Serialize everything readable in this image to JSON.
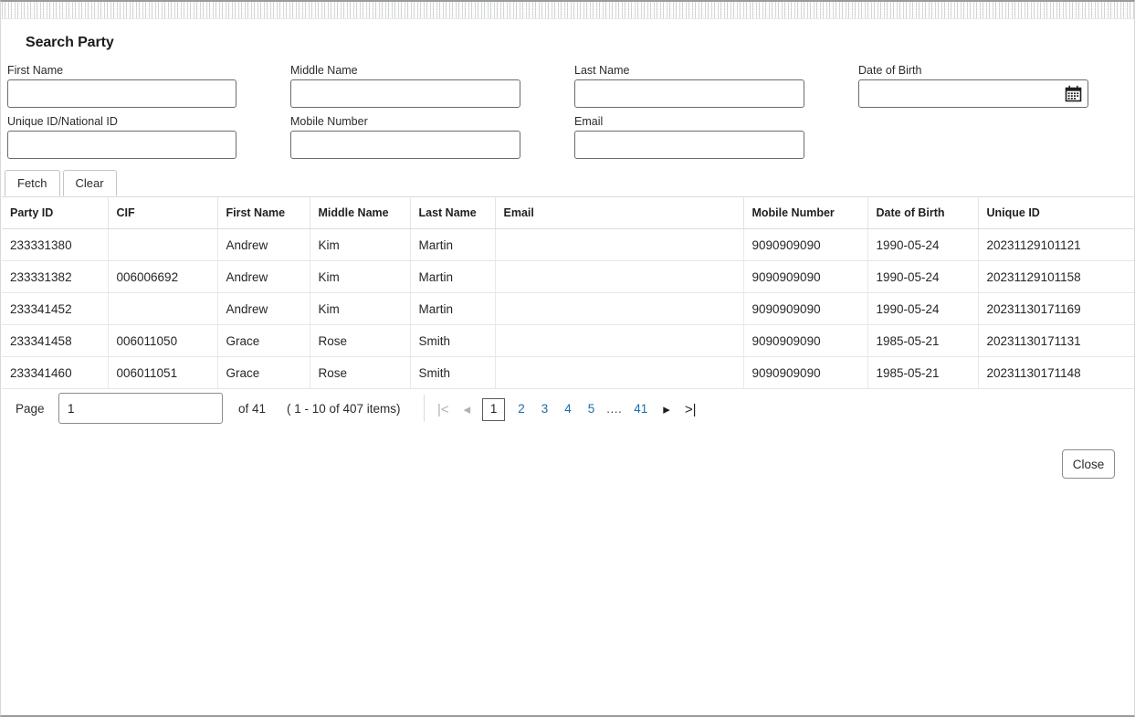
{
  "window": {
    "title": "Search Party"
  },
  "search_form": {
    "fields": [
      {
        "label": "First Name",
        "value": "",
        "placeholder": "",
        "name": "first-name"
      },
      {
        "label": "Middle Name",
        "value": "",
        "placeholder": "",
        "name": "middle-name"
      },
      {
        "label": "Last Name",
        "value": "",
        "placeholder": "",
        "name": "last-name"
      },
      {
        "label": "Date of Birth",
        "value": "",
        "placeholder": "",
        "name": "date-of-birth"
      },
      {
        "label": "Unique ID/National ID",
        "value": "",
        "placeholder": "",
        "name": "unique-id"
      },
      {
        "label": "Mobile Number",
        "value": "",
        "placeholder": "",
        "name": "mobile-number"
      },
      {
        "label": "Email",
        "value": "",
        "placeholder": "",
        "name": "email"
      }
    ],
    "calendar_icon": "calendar-icon",
    "buttons": {
      "fetch": "Fetch",
      "clear": "Clear"
    }
  },
  "results": {
    "columns": [
      "Party ID",
      "CIF",
      "First Name",
      "Middle Name",
      "Last Name",
      "Email",
      "Mobile Number",
      "Date of Birth",
      "Unique ID"
    ],
    "rows": [
      {
        "party_id": "233331380",
        "cif": "",
        "first_name": "Andrew",
        "middle_name": "Kim",
        "last_name": "Martin",
        "email": "",
        "mobile_number": "9090909090",
        "date_of_birth": "1990-05-24",
        "unique_id": "20231129101121"
      },
      {
        "party_id": "233331382",
        "cif": "006006692",
        "first_name": "Andrew",
        "middle_name": "Kim",
        "last_name": "Martin",
        "email": "",
        "mobile_number": "9090909090",
        "date_of_birth": "1990-05-24",
        "unique_id": "20231129101158"
      },
      {
        "party_id": "233341452",
        "cif": "",
        "first_name": "Andrew",
        "middle_name": "Kim",
        "last_name": "Martin",
        "email": "",
        "mobile_number": "9090909090",
        "date_of_birth": "1990-05-24",
        "unique_id": "20231130171169"
      },
      {
        "party_id": "233341458",
        "cif": "006011050",
        "first_name": "Grace",
        "middle_name": "Rose",
        "last_name": "Smith",
        "email": "",
        "mobile_number": "9090909090",
        "date_of_birth": "1985-05-21",
        "unique_id": "20231130171131"
      },
      {
        "party_id": "233341460",
        "cif": "006011051",
        "first_name": "Grace",
        "middle_name": "Rose",
        "last_name": "Smith",
        "email": "",
        "mobile_number": "9090909090",
        "date_of_birth": "1985-05-21",
        "unique_id": "20231130171148"
      }
    ]
  },
  "pagination": {
    "page_label": "Page",
    "page_value": "1",
    "of_label": "of 41",
    "items_label": "( 1 - 10 of 407 items)",
    "first_icon": "|<",
    "prev_icon": "◂",
    "next_icon": "▸",
    "last_icon": ">|",
    "pages": [
      "1",
      "2",
      "3",
      "4",
      "5",
      "....",
      "41"
    ],
    "current_page": "1",
    "link_color": "#1b6ea8"
  },
  "footer": {
    "close_label": "Close"
  }
}
